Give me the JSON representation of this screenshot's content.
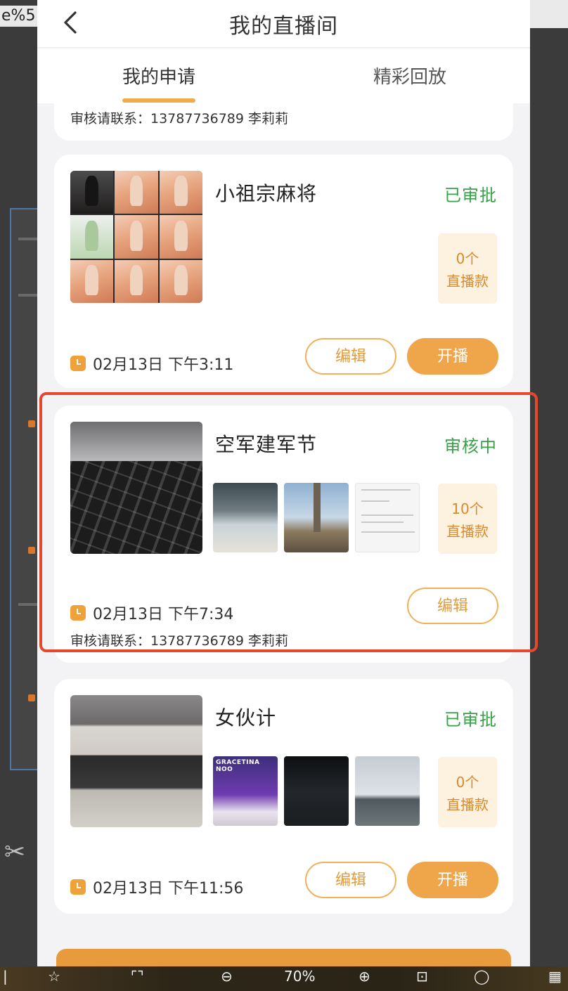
{
  "nav": {
    "title": "我的直播间"
  },
  "tabs": {
    "apply": "我的申请",
    "replay": "精彩回放"
  },
  "prev_card": {
    "contact": "审核请联系：13787736789 李莉莉"
  },
  "cards": [
    {
      "title": "小祖宗麻将",
      "status": "已审批",
      "count_line1": "0个",
      "count_line2": "直播款",
      "time": "02月13日 下午3:11",
      "edit_label": "编辑",
      "start_label": "开播"
    },
    {
      "title": "空军建军节",
      "status": "审核中",
      "count_line1": "10个",
      "count_line2": "直播款",
      "time": "02月13日 下午7:34",
      "contact": "审核请联系：13787736789 李莉莉",
      "edit_label": "编辑"
    },
    {
      "title": "女伙计",
      "status": "已审批",
      "count_line1": "0个",
      "count_line2": "直播款",
      "time": "02月13日 下午11:56",
      "edit_label": "编辑",
      "start_label": "开播",
      "poster_text": "GRACETINA NOO"
    }
  ],
  "viewer": {
    "zoom": "70%"
  },
  "colors": {
    "accent": "#efa54a",
    "approved": "#3aa04a",
    "highlight": "#e5492b"
  }
}
